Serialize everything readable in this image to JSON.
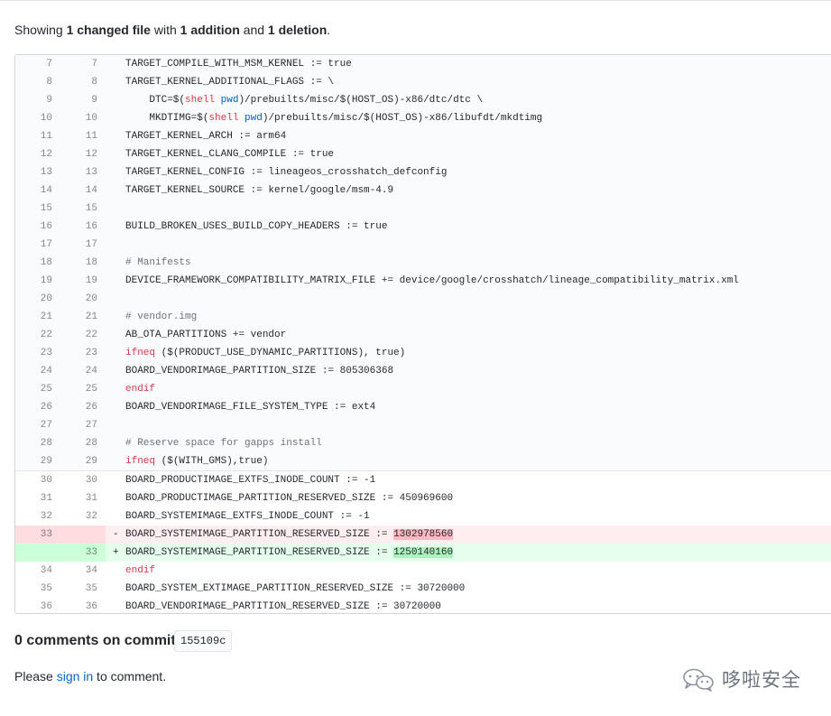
{
  "summary": {
    "prefix": "Showing ",
    "files": "1 changed file",
    "with": " with ",
    "additions": "1 addition",
    "and": " and ",
    "deletions": "1 deletion",
    "suffix": "."
  },
  "diff": {
    "lines": [
      {
        "old": "7",
        "new": "7",
        "type": "ctx",
        "code": "TARGET_COMPILE_WITH_MSM_KERNEL := true"
      },
      {
        "old": "8",
        "new": "8",
        "type": "ctx",
        "code": "TARGET_KERNEL_ADDITIONAL_FLAGS := \\"
      },
      {
        "old": "9",
        "new": "9",
        "type": "ctx",
        "code": "    DTC=$(shell pwd)/prebuilts/misc/$(HOST_OS)-x86/dtc/dtc \\"
      },
      {
        "old": "10",
        "new": "10",
        "type": "ctx",
        "code": "    MKDTIMG=$(shell pwd)/prebuilts/misc/$(HOST_OS)-x86/libufdt/mkdtimg"
      },
      {
        "old": "11",
        "new": "11",
        "type": "ctx",
        "code": "TARGET_KERNEL_ARCH := arm64"
      },
      {
        "old": "12",
        "new": "12",
        "type": "ctx",
        "code": "TARGET_KERNEL_CLANG_COMPILE := true"
      },
      {
        "old": "13",
        "new": "13",
        "type": "ctx",
        "code": "TARGET_KERNEL_CONFIG := lineageos_crosshatch_defconfig"
      },
      {
        "old": "14",
        "new": "14",
        "type": "ctx",
        "code": "TARGET_KERNEL_SOURCE := kernel/google/msm-4.9"
      },
      {
        "old": "15",
        "new": "15",
        "type": "ctx",
        "code": ""
      },
      {
        "old": "16",
        "new": "16",
        "type": "ctx",
        "code": "BUILD_BROKEN_USES_BUILD_COPY_HEADERS := true"
      },
      {
        "old": "17",
        "new": "17",
        "type": "ctx",
        "code": ""
      },
      {
        "old": "18",
        "new": "18",
        "type": "ctx",
        "code": "# Manifests"
      },
      {
        "old": "19",
        "new": "19",
        "type": "ctx",
        "code": "DEVICE_FRAMEWORK_COMPATIBILITY_MATRIX_FILE += device/google/crosshatch/lineage_compatibility_matrix.xml"
      },
      {
        "old": "20",
        "new": "20",
        "type": "ctx",
        "code": ""
      },
      {
        "old": "21",
        "new": "21",
        "type": "ctx",
        "code": "# vendor.img"
      },
      {
        "old": "22",
        "new": "22",
        "type": "ctx",
        "code": "AB_OTA_PARTITIONS += vendor"
      },
      {
        "old": "23",
        "new": "23",
        "type": "ctx",
        "code": "ifneq ($(PRODUCT_USE_DYNAMIC_PARTITIONS), true)"
      },
      {
        "old": "24",
        "new": "24",
        "type": "ctx",
        "code": "BOARD_VENDORIMAGE_PARTITION_SIZE := 805306368"
      },
      {
        "old": "25",
        "new": "25",
        "type": "ctx",
        "code": "endif"
      },
      {
        "old": "26",
        "new": "26",
        "type": "ctx",
        "code": "BOARD_VENDORIMAGE_FILE_SYSTEM_TYPE := ext4"
      },
      {
        "old": "27",
        "new": "27",
        "type": "ctx",
        "code": ""
      },
      {
        "old": "28",
        "new": "28",
        "type": "ctx",
        "code": "# Reserve space for gapps install"
      },
      {
        "old": "29",
        "new": "29",
        "type": "ctx",
        "code": "ifneq ($(WITH_GMS),true)"
      },
      {
        "old": "30",
        "new": "30",
        "type": "norm",
        "code": "BOARD_PRODUCTIMAGE_EXTFS_INODE_COUNT := -1"
      },
      {
        "old": "31",
        "new": "31",
        "type": "norm",
        "code": "BOARD_PRODUCTIMAGE_PARTITION_RESERVED_SIZE := 450969600"
      },
      {
        "old": "32",
        "new": "32",
        "type": "norm",
        "code": "BOARD_SYSTEMIMAGE_EXTFS_INODE_COUNT := -1"
      },
      {
        "old": "33",
        "new": "",
        "type": "del",
        "marker": "-",
        "code": "BOARD_SYSTEMIMAGE_PARTITION_RESERVED_SIZE := ",
        "hl": "1302978560"
      },
      {
        "old": "",
        "new": "33",
        "type": "add",
        "marker": "+",
        "code": "BOARD_SYSTEMIMAGE_PARTITION_RESERVED_SIZE := ",
        "hl": "1250140160"
      },
      {
        "old": "34",
        "new": "34",
        "type": "norm",
        "code": "endif"
      },
      {
        "old": "35",
        "new": "35",
        "type": "norm",
        "code": "BOARD_SYSTEM_EXTIMAGE_PARTITION_RESERVED_SIZE := 30720000"
      },
      {
        "old": "36",
        "new": "36",
        "type": "norm",
        "code": "BOARD_VENDORIMAGE_PARTITION_RESERVED_SIZE := 30720000"
      }
    ]
  },
  "comments": {
    "title": "0 comments on commit",
    "sha": "155109c",
    "please": "Please ",
    "sign_in": "sign in",
    "to_comment": " to comment."
  },
  "watermark": {
    "text": "哆啦安全",
    "icon": "wechat-icon"
  },
  "colors": {
    "deletion_bg": "#ffeef0",
    "addition_bg": "#e6ffed",
    "link": "#0366d6"
  }
}
